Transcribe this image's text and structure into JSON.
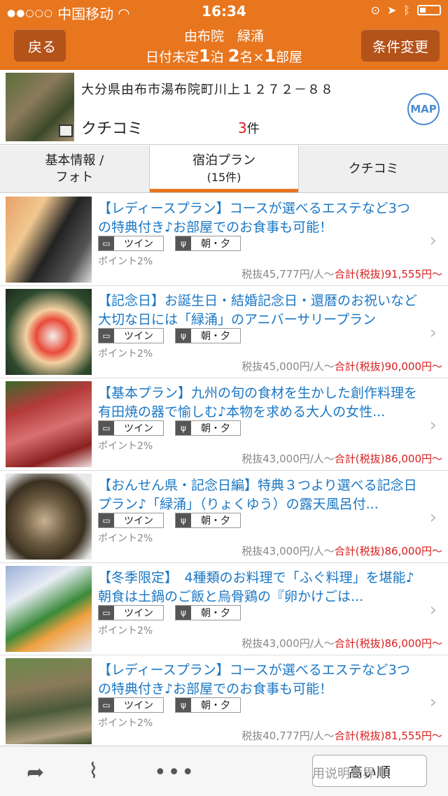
{
  "status_bar": {
    "dots": "●●○○○",
    "carrier": "中国移动",
    "time": "16:34"
  },
  "nav": {
    "back_label": "戻る",
    "title_line1": "由布院　緑涌",
    "title_pre": "日付未定",
    "nights": "1",
    "nights_unit": "泊",
    "guests": "2",
    "guests_unit": "名×",
    "rooms": "1",
    "rooms_unit": "部屋",
    "condition_label": "条件変更"
  },
  "hotel": {
    "address": "大分県由布市湯布院町川上１２７２－８８",
    "review_label": "クチコミ",
    "review_count": "3",
    "review_unit": "件",
    "map_label": "MAP"
  },
  "tabs": [
    {
      "line1": "基本情報 /",
      "line2": "フォト"
    },
    {
      "line1": "宿泊プラン",
      "line2": "(15件)"
    },
    {
      "line1": "クチコミ",
      "line2": ""
    }
  ],
  "plans": [
    {
      "title": "【レディースプラン】コースが選べるエステなど3つの特典付き♪お部屋でのお食事も可能！",
      "room": "ツイン",
      "meal": "朝・夕",
      "point": "ポイント2%",
      "price": "税抜45,777円/人～",
      "total": "合計(税抜)91,555円～"
    },
    {
      "title": "【記念日】お誕生日・結婚記念日・還暦のお祝いなど大切な日には「緑涌」のアニバーサリープラン",
      "room": "ツイン",
      "meal": "朝・夕",
      "point": "ポイント2%",
      "price": "税抜45,000円/人～",
      "total": "合計(税抜)90,000円～"
    },
    {
      "title": "【基本プラン】九州の旬の食材を生かした創作料理を有田焼の器で愉しむ♪本物を求める大人の女性...",
      "room": "ツイン",
      "meal": "朝・夕",
      "point": "ポイント2%",
      "price": "税抜43,000円/人～",
      "total": "合計(税抜)86,000円～"
    },
    {
      "title": "【おんせん県・記念日編】特典３つより選べる記念日プラン♪「緑涌」（りょくゆう）の露天風呂付...",
      "room": "ツイン",
      "meal": "朝・夕",
      "point": "ポイント2%",
      "price": "税抜43,000円/人～",
      "total": "合計(税抜)86,000円～"
    },
    {
      "title": "【冬季限定】　4種類のお料理で「ふぐ料理」を堪能♪　朝食は土鍋のご飯と烏骨鶏の『卵かけごは...",
      "room": "ツイン",
      "meal": "朝・夕",
      "point": "ポイント2%",
      "price": "税抜43,000円/人～",
      "total": "合計(税抜)86,000円～"
    },
    {
      "title": "【レディースプラン】コースが選べるエステなど3つの特典付き♪お部屋でのお食事も可能！",
      "room": "ツイン",
      "meal": "朝・夕",
      "point": "ポイント2%",
      "price": "税抜40,777円/人～",
      "total": "合計(税抜)81,555円～"
    }
  ],
  "toolbar": {
    "sort_label": "高い順",
    "watermark": "用说明世界"
  },
  "colors": {
    "accent": "#e8761f",
    "button_dark": "#b3531a",
    "link_blue": "#1a77c4",
    "price_red": "#d81e1e"
  }
}
